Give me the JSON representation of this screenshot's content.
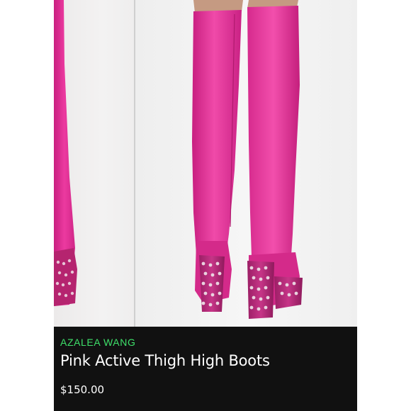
{
  "product": {
    "brand": "AZALEA WANG",
    "title": "Pink Active Thigh High Boots",
    "price": "$150.00"
  },
  "colors": {
    "boot_pink": "#e8329a",
    "brand_green": "#3ee06a",
    "panel_dark": "#111111"
  }
}
